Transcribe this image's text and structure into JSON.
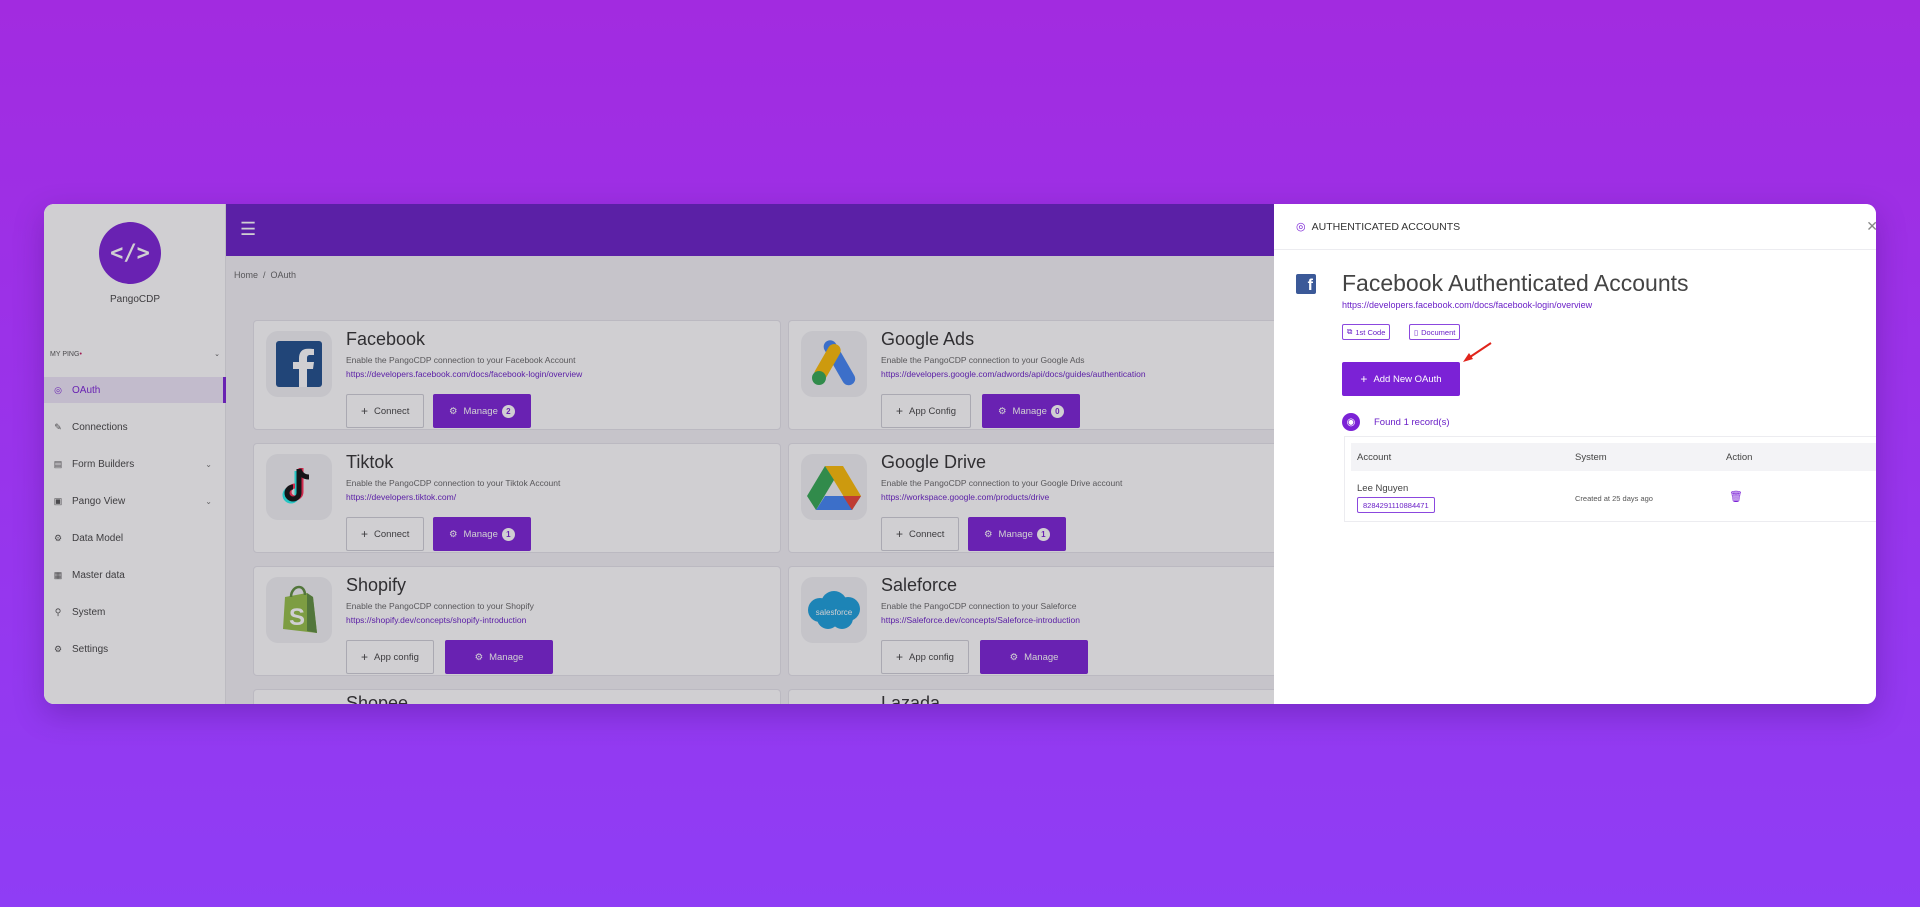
{
  "app": {
    "name": "PangoCDP",
    "logo_glyph": "</>",
    "workspace": "MY PING",
    "workspace_marker": "•"
  },
  "sidebar": {
    "items": [
      {
        "label": "OAuth",
        "icon": "lock-icon",
        "glyph": "◎",
        "active": true
      },
      {
        "label": "Connections",
        "icon": "link-icon",
        "glyph": "✎"
      },
      {
        "label": "Form Builders",
        "icon": "form-icon",
        "glyph": "▤",
        "chevron": true
      },
      {
        "label": "Pango View",
        "icon": "view-icon",
        "glyph": "▣",
        "chevron": true
      },
      {
        "label": "Data Model",
        "icon": "data-model-icon",
        "glyph": "⚙"
      },
      {
        "label": "Master data",
        "icon": "master-data-icon",
        "glyph": "▦"
      },
      {
        "label": "System",
        "icon": "system-icon",
        "glyph": "⚲"
      },
      {
        "label": "Settings",
        "icon": "settings-icon",
        "glyph": "⚙"
      }
    ]
  },
  "breadcrumb": {
    "home": "Home",
    "sep": "/",
    "current": "OAuth"
  },
  "cards": [
    {
      "title": "Facebook",
      "desc": "Enable the PangoCDP connection to your Facebook Account",
      "link": "https://developers.facebook.com/docs/facebook-login/overview",
      "btn1": "Connect",
      "btn2": "Manage",
      "badge": "2"
    },
    {
      "title": "Google Ads",
      "desc": "Enable the PangoCDP connection to your Google Ads",
      "link": "https://developers.google.com/adwords/api/docs/guides/authentication",
      "btn1": "App Config",
      "btn2": "Manage",
      "badge": "0"
    },
    {
      "title": "Tiktok",
      "desc": "Enable the PangoCDP connection to your Tiktok Account",
      "link": "https://developers.tiktok.com/",
      "btn1": "Connect",
      "btn2": "Manage",
      "badge": "1"
    },
    {
      "title": "Google Drive",
      "desc": "Enable the PangoCDP connection to your Google Drive account",
      "link": "https://workspace.google.com/products/drive",
      "btn1": "Connect",
      "btn2": "Manage",
      "badge": "1"
    },
    {
      "title": "Shopify",
      "desc": "Enable the PangoCDP connection to your Shopify",
      "link": "https://shopify.dev/concepts/shopify-introduction",
      "btn1": "App config",
      "btn2": "Manage"
    },
    {
      "title": "Saleforce",
      "desc": "Enable the PangoCDP connection to your Saleforce",
      "link": "https://Saleforce.dev/concepts/Saleforce-introduction",
      "btn1": "App config",
      "btn2": "Manage",
      "logo_text": "salesforce"
    },
    {
      "title": "Shopee"
    },
    {
      "title": "Lazada"
    }
  ],
  "drawer": {
    "header": "AUTHENTICATED ACCOUNTS",
    "title": "Facebook Authenticated Accounts",
    "fb_letter": "f",
    "link": "https://developers.facebook.com/docs/facebook-login/overview",
    "tag1": "1st Code",
    "tag2": "Document",
    "add_button": "Add New OAuth",
    "found": "Found 1 record(s)",
    "table": {
      "headers": [
        "Account",
        "System",
        "Action"
      ],
      "rows": [
        {
          "name": "Lee Nguyen",
          "id": "8284291110884471",
          "system": "Created at 25 days ago"
        }
      ]
    }
  },
  "colors": {
    "brand": "#7b22d6",
    "topbar": "#6a1fc7",
    "background_top": "#a22be0",
    "background_bottom": "#8f3df5",
    "annotation_arrow": "#e0241b"
  }
}
